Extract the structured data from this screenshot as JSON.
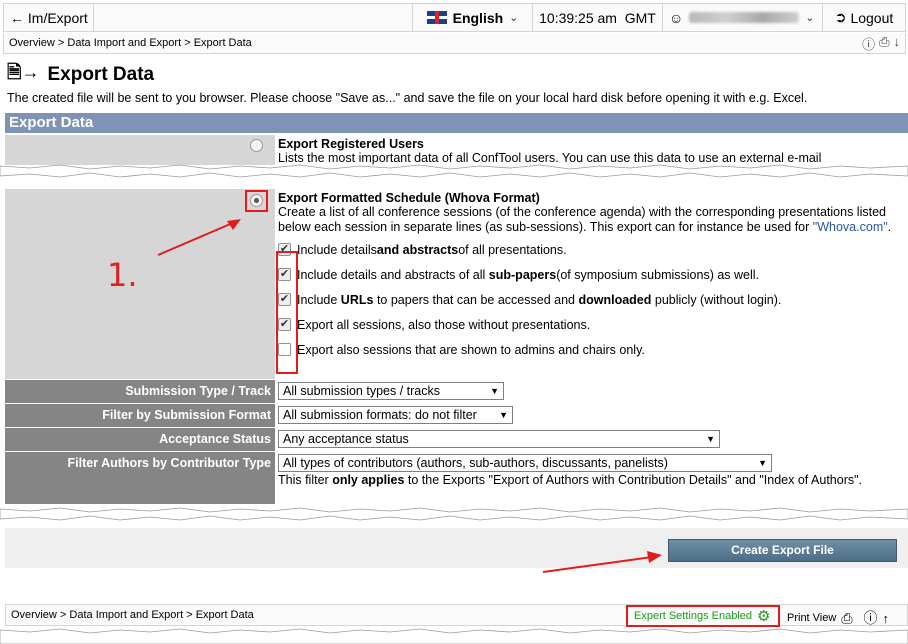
{
  "topbar": {
    "back_label": "Im/Export",
    "language": "English",
    "time": "10:39:25 am",
    "timezone": "GMT",
    "logout_label": "Logout"
  },
  "breadcrumb": {
    "overview": "Overview",
    "separator": ">",
    "data_import_export": "Data Import and Export",
    "current": "Export Data"
  },
  "page": {
    "title": "Export Data",
    "intro": "The created file will be sent to you browser. Please choose \"Save as...\" and save the file on your local hard disk before opening it with e.g. Excel."
  },
  "section": {
    "header": "Export Data"
  },
  "options": {
    "registered_users": {
      "title": "Export Registered Users",
      "text": "Lists the most important data of all ConfTool users. You can use this data to use an external e-mail"
    },
    "whova": {
      "title": "Export Formatted Schedule (Whova Format)",
      "text": "Create a list of all conference sessions (of the conference agenda) with the corresponding presentations listed below each session in separate lines (as sub-sessions). This export can for instance be used for",
      "link": "\"Whova.com\"",
      "link_suffix": ".",
      "checkboxes": [
        {
          "checked": true,
          "parts": [
            "Include details ",
            "and abstracts",
            " of all presentations."
          ]
        },
        {
          "checked": true,
          "parts": [
            "Include details and abstracts of all ",
            "sub-papers",
            " (of symposium submissions) as well."
          ]
        },
        {
          "checked": true,
          "parts_multi": [
            "Include ",
            "URLs",
            " to papers that can be accessed and ",
            "downloaded",
            " publicly (without login)."
          ]
        },
        {
          "checked": true,
          "parts": [
            "Export all sessions, also those without presentations.",
            "",
            ""
          ]
        },
        {
          "checked": false,
          "parts": [
            "Export also sessions that are shown to admins and chairs only.",
            "",
            ""
          ]
        }
      ]
    }
  },
  "filters": [
    {
      "label": "Submission Type / Track",
      "value": "All submission types / tracks"
    },
    {
      "label": "Filter by Submission Format",
      "value": "All submission formats: do not filter"
    },
    {
      "label": "Acceptance Status",
      "value": "Any acceptance status"
    },
    {
      "label": "Filter Authors by Contributor Type",
      "value": "All types of contributors (authors, sub-authors, discussants, panelists)"
    }
  ],
  "filter_note": {
    "prefix": "This filter ",
    "bold": "only applies",
    "suffix": " to the Exports \"Export of Authors with Contribution Details\" and \"Index of Authors\"."
  },
  "actions": {
    "create_label": "Create Export File"
  },
  "footer": {
    "expert_label": "Expert Settings Enabled",
    "print_label": "Print View"
  },
  "annotation": {
    "number": "1."
  },
  "colors": {
    "section_header": "#7f93b6",
    "label_bg": "#858585",
    "highlight": "#e31b1b",
    "expert_green": "#1e9a1e"
  }
}
